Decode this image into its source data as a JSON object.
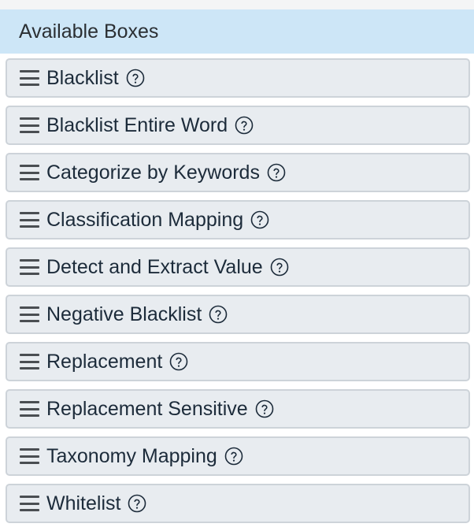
{
  "panel": {
    "title": "Available Boxes"
  },
  "icons": {
    "drag": "drag-handle-icon",
    "help": "question-circle-icon"
  },
  "colors": {
    "header_bg": "#cde6f7",
    "item_bg": "#e8ecf0",
    "item_border": "#cdd3d9",
    "text": "#1c2b3a"
  },
  "boxes": [
    {
      "label": "Blacklist"
    },
    {
      "label": "Blacklist Entire Word"
    },
    {
      "label": "Categorize by Keywords"
    },
    {
      "label": "Classification Mapping"
    },
    {
      "label": "Detect and Extract Value"
    },
    {
      "label": "Negative Blacklist"
    },
    {
      "label": "Replacement"
    },
    {
      "label": "Replacement Sensitive"
    },
    {
      "label": "Taxonomy Mapping"
    },
    {
      "label": "Whitelist"
    }
  ]
}
